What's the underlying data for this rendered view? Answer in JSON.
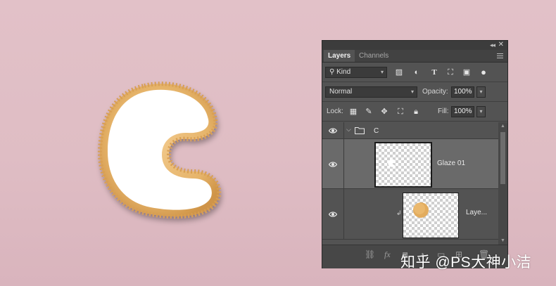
{
  "panel": {
    "tabs": [
      "Layers",
      "Channels"
    ],
    "filter": {
      "kind_label": "Kind"
    },
    "blend_mode": "Normal",
    "opacity_label": "Opacity:",
    "opacity_value": "100%",
    "lock_label": "Lock:",
    "fill_label": "Fill:",
    "fill_value": "100%",
    "layers": [
      {
        "name": "C",
        "type": "group",
        "visible": true,
        "expanded": true
      },
      {
        "name": "Glaze 01",
        "type": "layer",
        "visible": true,
        "selected": true
      },
      {
        "name": "Laye...",
        "type": "clipped-layer",
        "visible": true
      }
    ]
  },
  "watermark": "知乎 @PS大神小洁",
  "colors": {
    "background": "#e0bfc6",
    "panel_bg": "#535353",
    "selected_row": "#6a6a6a",
    "cookie": "#e3b56c",
    "glaze": "#ffffff"
  }
}
